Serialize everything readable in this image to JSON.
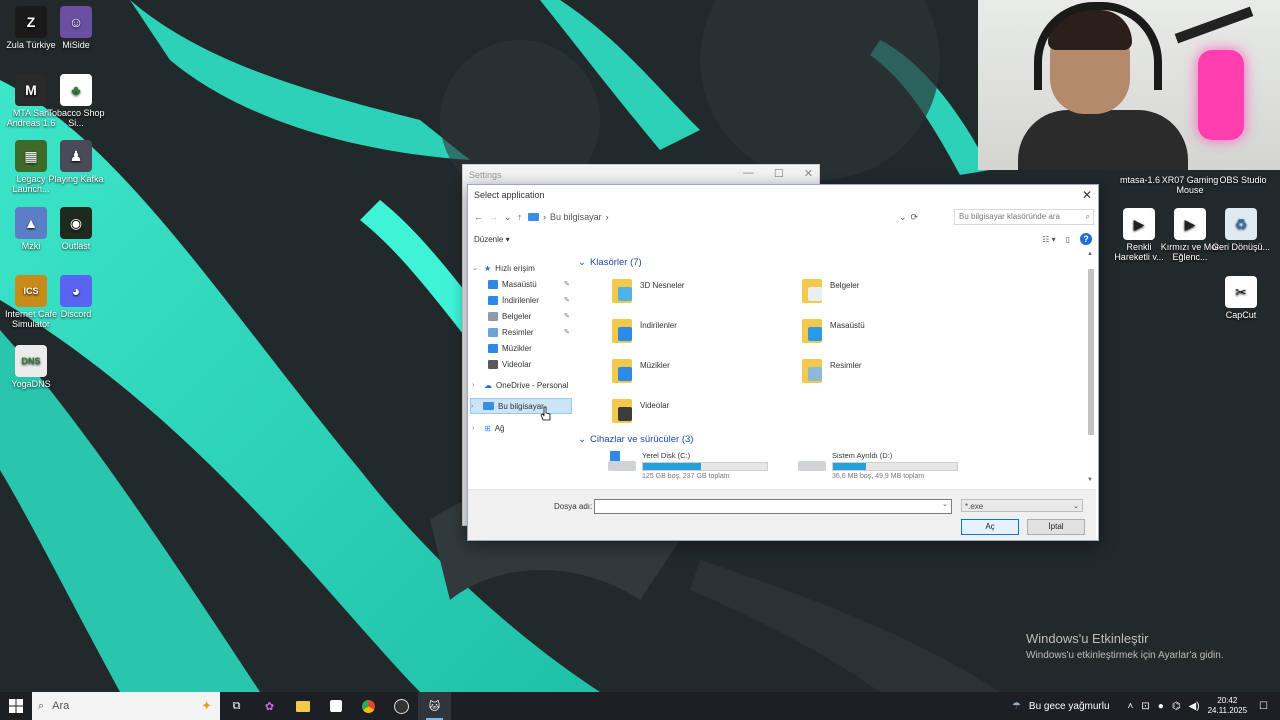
{
  "desktop": {
    "left_icons": [
      {
        "label": "Zula Türkiye",
        "icon": "zula-icon",
        "color": "#1a1a1a",
        "glyph": "Z"
      },
      {
        "label": "MiSide",
        "icon": "miside-icon",
        "color": "#6a4fa3",
        "glyph": "☺"
      },
      {
        "label": "MTA San Andreas 1.6",
        "icon": "mta-icon",
        "color": "#2a2a2a",
        "glyph": "M"
      },
      {
        "label": "Tobacco Shop Si...",
        "icon": "tobacco-icon",
        "color": "#ffffff",
        "glyph": "♣"
      },
      {
        "label": "Legacy Launch...",
        "icon": "legacy-icon",
        "color": "#3d6b2a",
        "glyph": "▦"
      },
      {
        "label": "Playing Kafka",
        "icon": "kafka-icon",
        "color": "#4a4a58",
        "glyph": "♟"
      },
      {
        "label": "Mzki",
        "icon": "mzki-icon",
        "color": "#5b7ec7",
        "glyph": "▲"
      },
      {
        "label": "Outlast",
        "icon": "outlast-icon",
        "color": "#1e2a1e",
        "glyph": "◉"
      },
      {
        "label": "Internet Cafe Simulator",
        "icon": "ics-icon",
        "color": "#c98a1a",
        "glyph": "ICS"
      },
      {
        "label": "Discord",
        "icon": "discord-icon",
        "color": "#5865f2",
        "glyph": "◕"
      },
      {
        "label": "YogaDNS",
        "icon": "yogadns-icon",
        "color": "#ececec",
        "glyph": "DNS"
      }
    ],
    "right_top_labels": [
      "mtasa-1.6",
      "XR07 Gaming Mouse",
      "OBS Studio"
    ],
    "right_icons": [
      {
        "label": "Renkli Hareketli v...",
        "icon": "video-icon",
        "glyph": "▶"
      },
      {
        "label": "Kırmızı ve Mor Eğlenc...",
        "icon": "video-icon",
        "glyph": "▶"
      },
      {
        "label": "Geri Dönüşü...",
        "icon": "recycle-bin-icon",
        "glyph": "♻"
      },
      {
        "label": "CapCut",
        "icon": "capcut-icon",
        "glyph": "✂"
      }
    ]
  },
  "settings_window": {
    "title": "Settings",
    "controls": [
      "—",
      "☐",
      "✕"
    ]
  },
  "dialog": {
    "title": "Select application",
    "close": "✕",
    "address": {
      "back": "←",
      "forward": "→",
      "recent": "⌄",
      "up": "↑",
      "path_sep": "›",
      "path": "Bu bilgisayar",
      "path_end": "›",
      "dropdown": "⌄",
      "refresh": "⟳"
    },
    "search_placeholder": "Bu bilgisayar klasöründe ara",
    "toolbar": {
      "organize": "Düzenle ▾",
      "view": "☷ ▾",
      "pane": "▯",
      "help": "?"
    },
    "nav": {
      "quick_access": "Hızlı erişim",
      "items": [
        {
          "label": "Masaüstü",
          "pinned": true,
          "color": "#2d8ae6"
        },
        {
          "label": "İndirilenler",
          "pinned": true,
          "color": "#2d8ae6"
        },
        {
          "label": "Belgeler",
          "pinned": true,
          "color": "#8e9aa8"
        },
        {
          "label": "Resimler",
          "pinned": true,
          "color": "#6aa3d8"
        },
        {
          "label": "Müzikler",
          "pinned": false,
          "color": "#2d8ae6"
        },
        {
          "label": "Videolar",
          "pinned": false,
          "color": "#5a5a5a"
        }
      ],
      "onedrive": "OneDrive - Personal",
      "this_pc": "Bu bilgisayar",
      "network": "Ağ",
      "pin_glyph": "📌"
    },
    "content": {
      "folders_header": "Klasörler (7)",
      "folders": [
        {
          "name": "3D Nesneler",
          "sym_color": "#4fb3e6"
        },
        {
          "name": "Belgeler",
          "sym_color": "#e9eef3"
        },
        {
          "name": "İndirilenler",
          "sym_color": "#2d8ae6"
        },
        {
          "name": "Masaüstü",
          "sym_color": "#2a9ae8"
        },
        {
          "name": "Müzikler",
          "sym_color": "#2d8ae6"
        },
        {
          "name": "Resimler",
          "sym_color": "#8fb7d9"
        },
        {
          "name": "Videolar",
          "sym_color": "#3c3c3c"
        }
      ],
      "drives_header": "Cihazlar ve sürücüler (3)",
      "drives": [
        {
          "name": "Yerel Disk (C:)",
          "info": "125 GB boş, 237 GB toplam",
          "used_fraction": 0.47
        },
        {
          "name": "Sistem Ayrıldı (D:)",
          "info": "36,6 MB boş, 49,9 MB toplam",
          "used_fraction": 0.27
        }
      ]
    },
    "filename_label": "Dosya adı:",
    "filename_value": "",
    "filter": "*.exe",
    "open_button": "Aç",
    "cancel_button": "İptal"
  },
  "watermark": {
    "title": "Windows'u Etkinleştir",
    "subtitle": "Windows'u etkinleştirmek için Ayarlar'a gidin."
  },
  "taskbar": {
    "search_placeholder": "Ara",
    "weather": "Bu gece yağmurlu",
    "time": "20:42",
    "date": "24.11.2025"
  }
}
